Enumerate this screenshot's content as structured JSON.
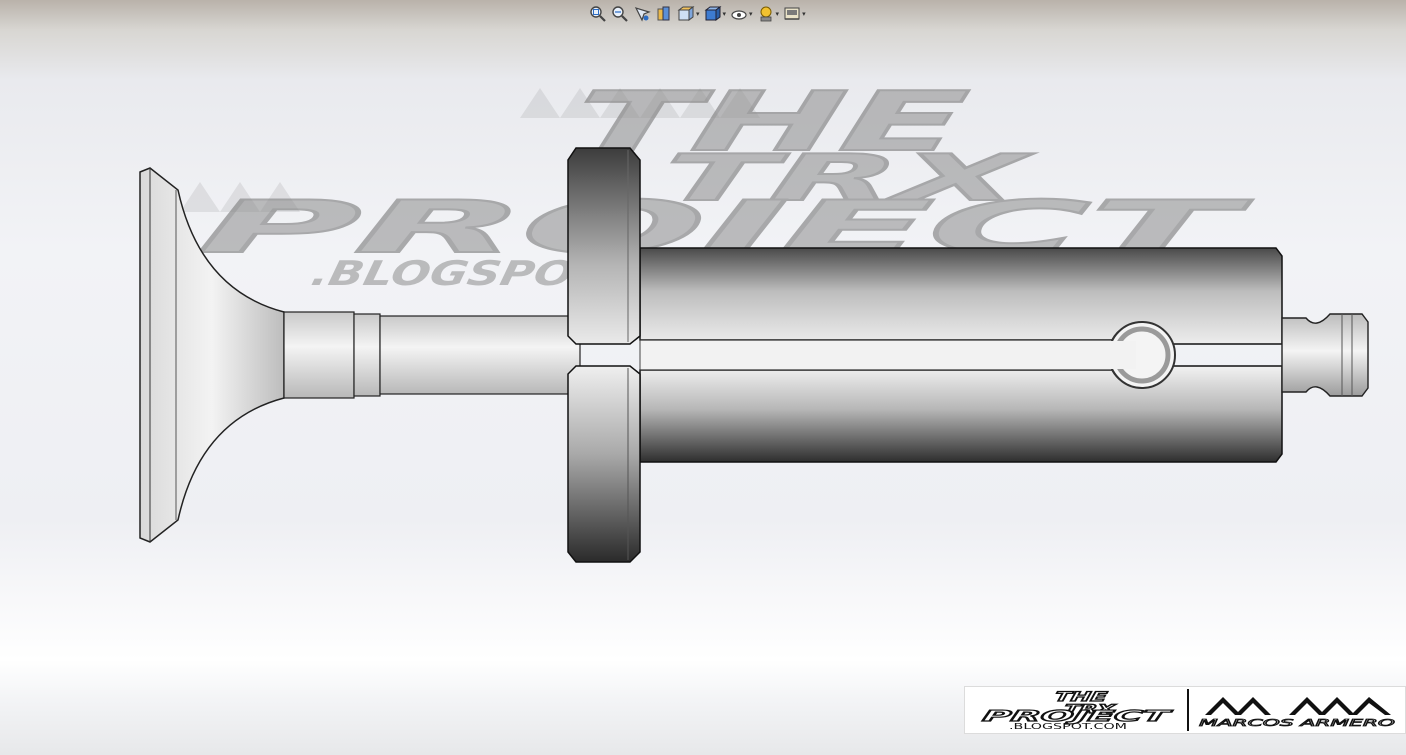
{
  "toolbar": {
    "buttons": [
      {
        "icon": "zoom-to-fit-icon",
        "has_menu": false
      },
      {
        "icon": "zoom-to-area-icon",
        "has_menu": false
      },
      {
        "icon": "previous-view-icon",
        "has_menu": false
      },
      {
        "icon": "section-view-icon",
        "has_menu": false
      },
      {
        "icon": "view-orientation-icon",
        "has_menu": true
      },
      {
        "icon": "display-style-icon",
        "has_menu": true
      },
      {
        "icon": "hide-show-items-icon",
        "has_menu": true
      },
      {
        "icon": "edit-appearance-icon",
        "has_menu": true
      },
      {
        "icon": "apply-scene-icon",
        "has_menu": true
      }
    ]
  },
  "watermark": {
    "line1": "THE",
    "line2": "TRX",
    "line3": "PROJECT",
    "line4": ".BLOGSPOT.COM"
  },
  "logo": {
    "trx_line1": "THE",
    "trx_line2": "TRX",
    "trx_line3": "PROJECT",
    "trx_line4": ".BLOGSPOT.COM",
    "author_mark": "MM",
    "author_name": "MARCOS ARMERO"
  },
  "colors": {
    "metal_dark": "#3a3a3a",
    "metal_light": "#f4f4f4",
    "watermark": "#8c8c8c"
  }
}
